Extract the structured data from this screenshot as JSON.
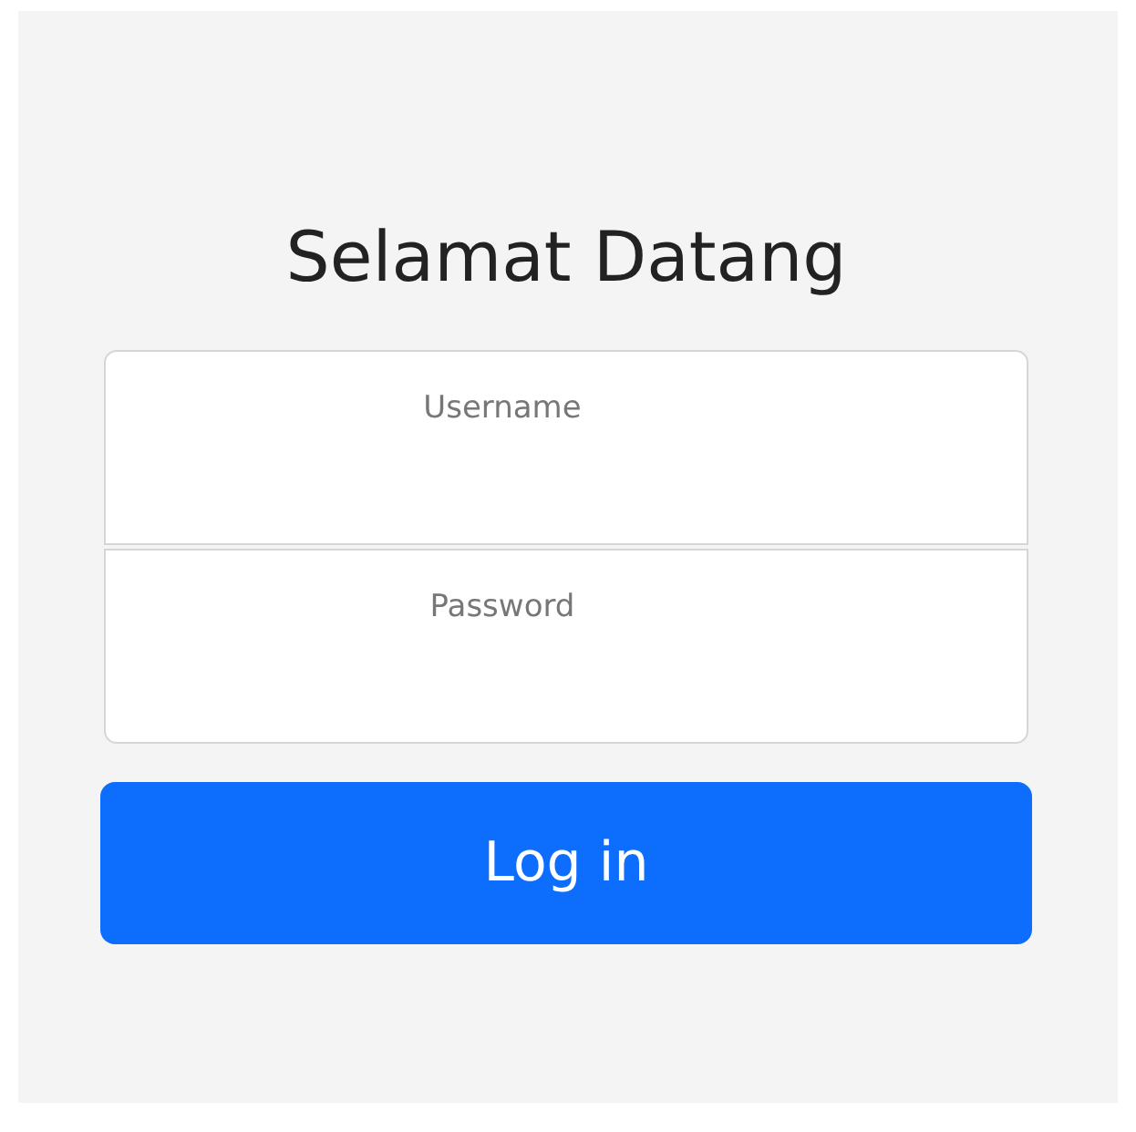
{
  "title": "Selamat Datang",
  "fields": [
    {
      "placeholder": "Username"
    },
    {
      "placeholder": "Password"
    }
  ],
  "button": "Log in"
}
